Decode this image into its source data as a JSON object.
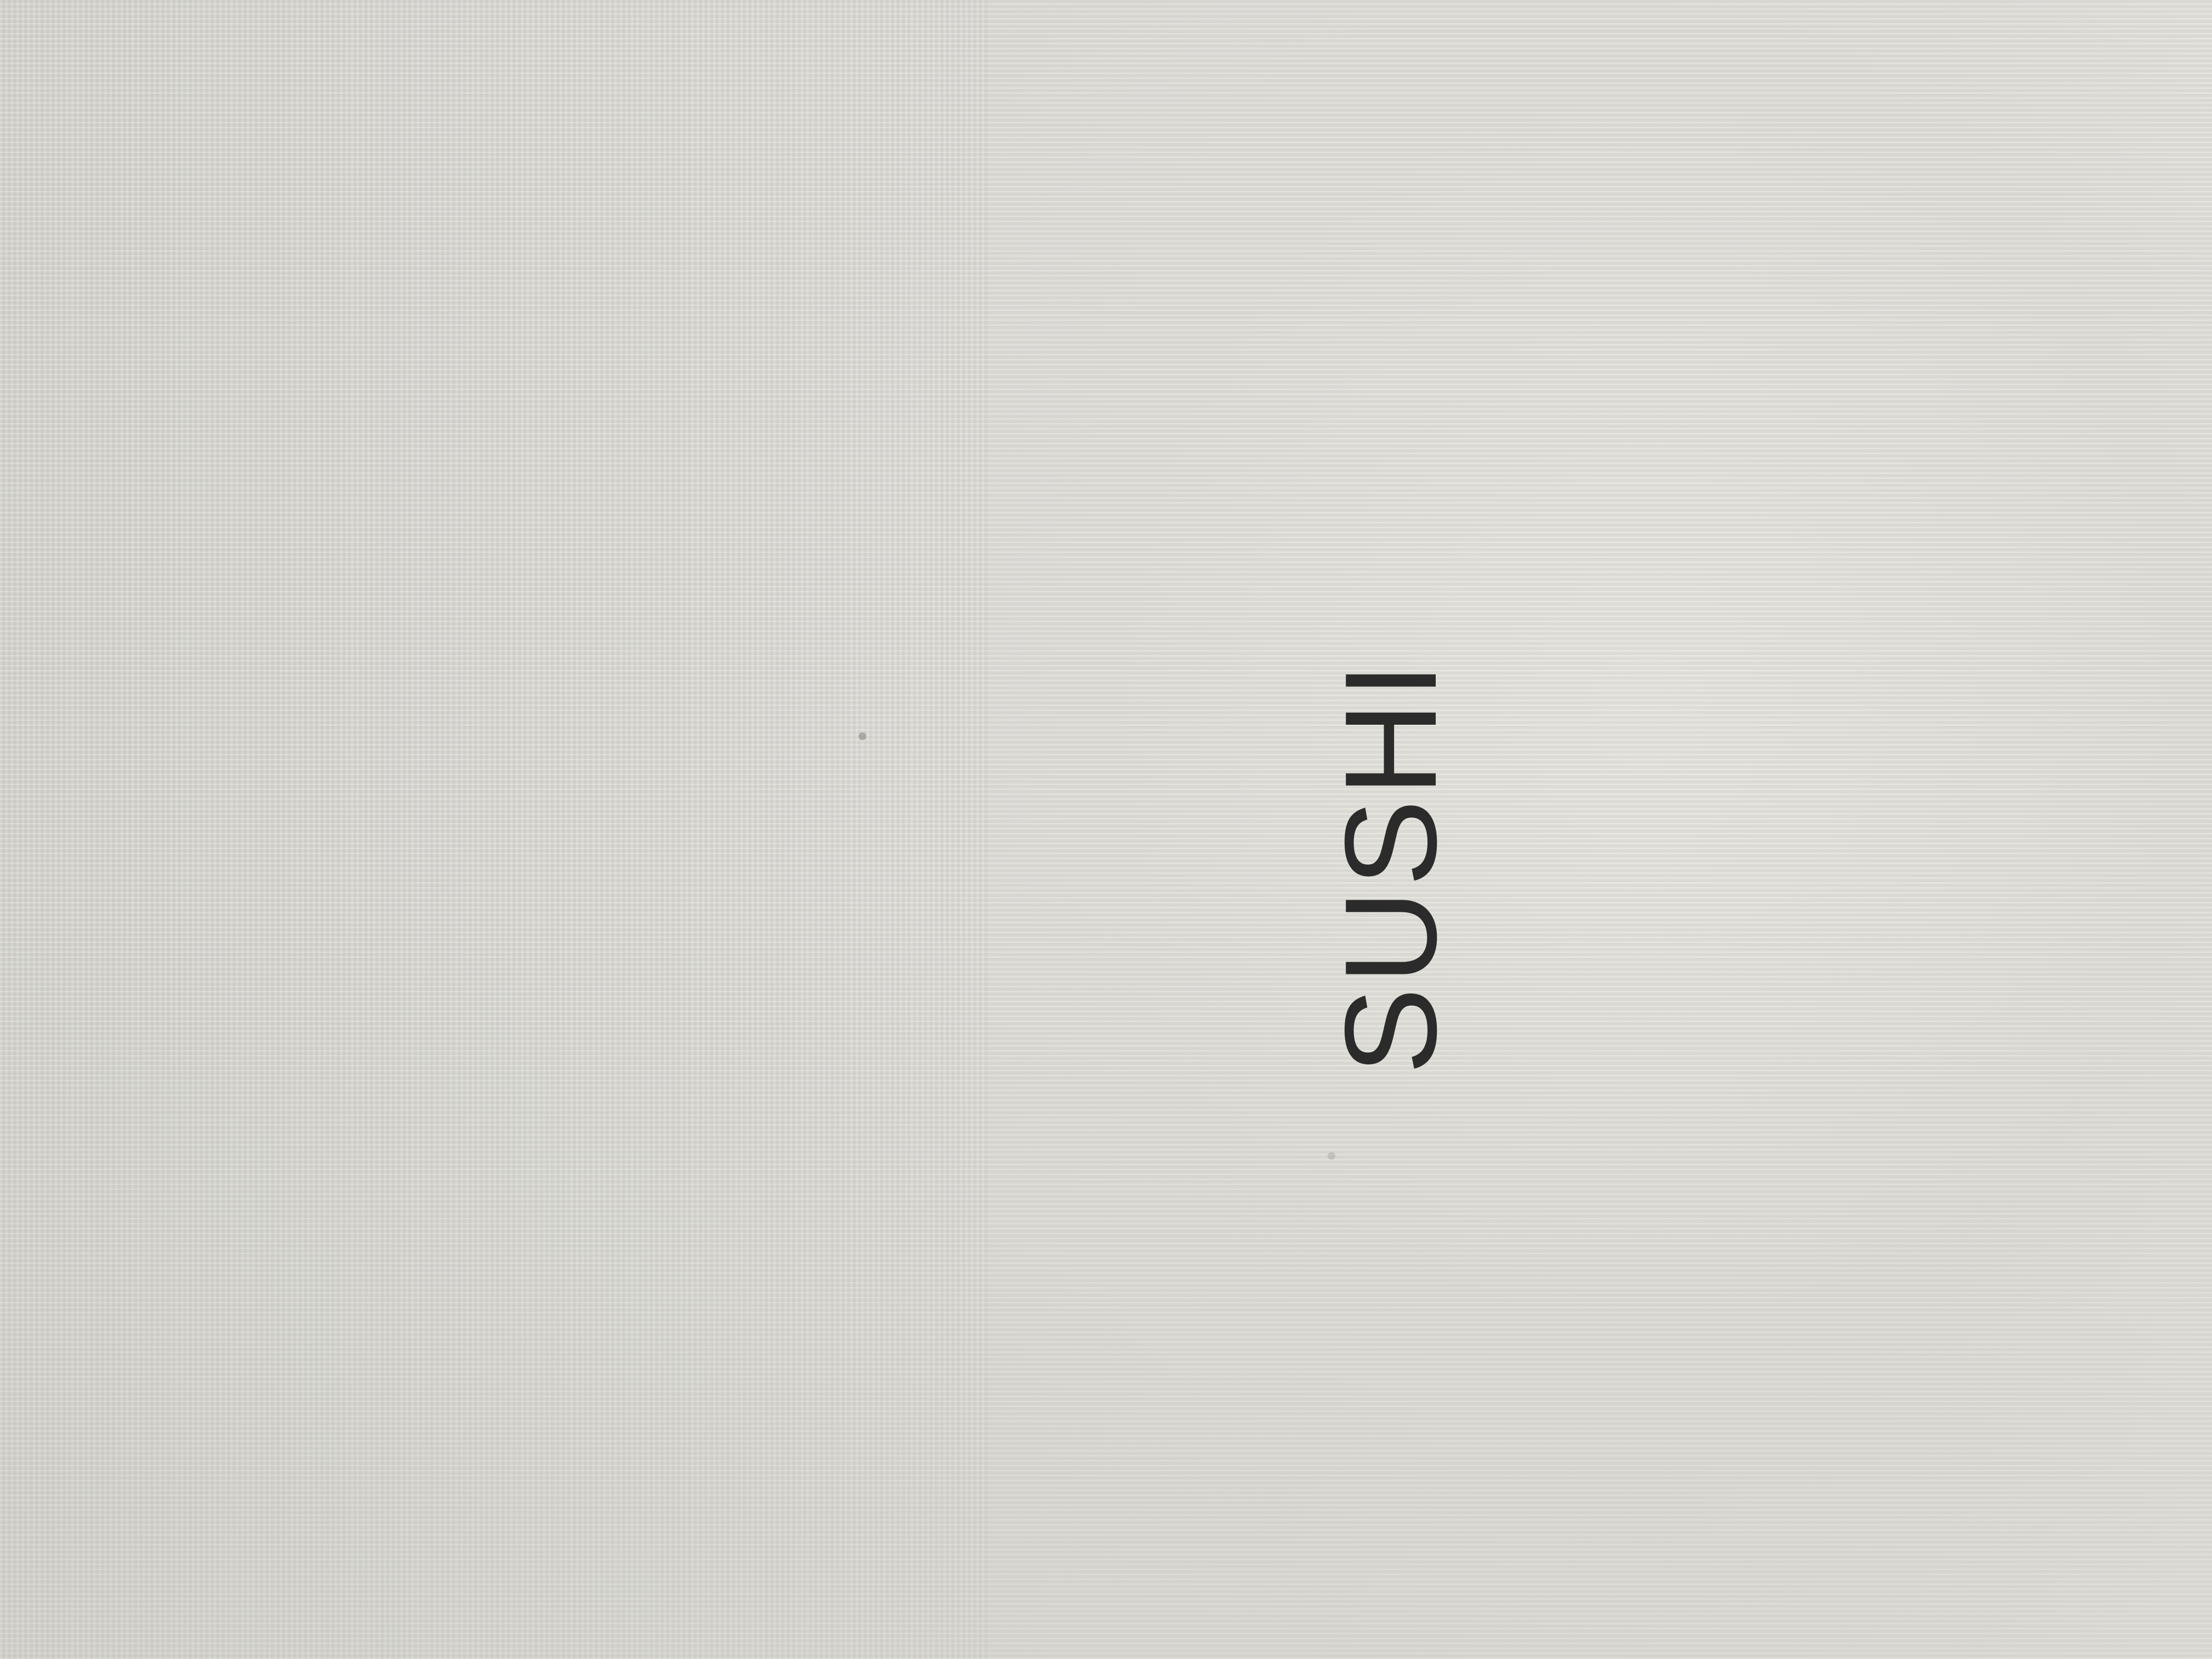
{
  "photo": {
    "subject": "paper-surface",
    "printed_text": "SUSHI",
    "colors": {
      "background": "#dfddd7",
      "text": "#2b2b2b"
    }
  }
}
